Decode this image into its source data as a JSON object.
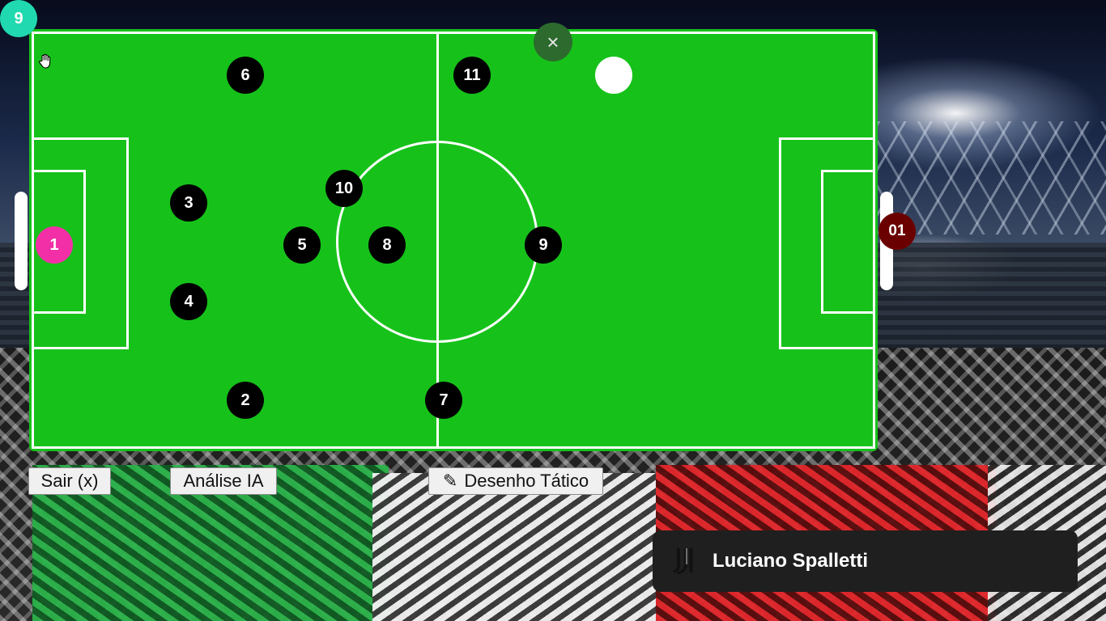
{
  "counter_badge": "9",
  "close_symbol": "×",
  "players": {
    "p1": "1",
    "p2": "2",
    "p3": "3",
    "p4": "4",
    "p5": "5",
    "p6": "6",
    "p7": "7",
    "p8": "8",
    "p9": "9",
    "p10": "10",
    "p11": "11"
  },
  "opponent_marker": "01",
  "buttons": {
    "exit": "Sair (x)",
    "ai_analysis": "Análise IA",
    "tactical_drawing": "Desenho Tático",
    "pencil_glyph": "✎"
  },
  "coach": {
    "name": "Luciano Spalletti",
    "logo_icon": "juventus-logo-icon"
  },
  "colors": {
    "pitch": "#16c21a",
    "player": "#000000",
    "goalkeeper": "#f22fa6",
    "opponent": "#6b0000",
    "counter_badge": "#20d9b0"
  }
}
